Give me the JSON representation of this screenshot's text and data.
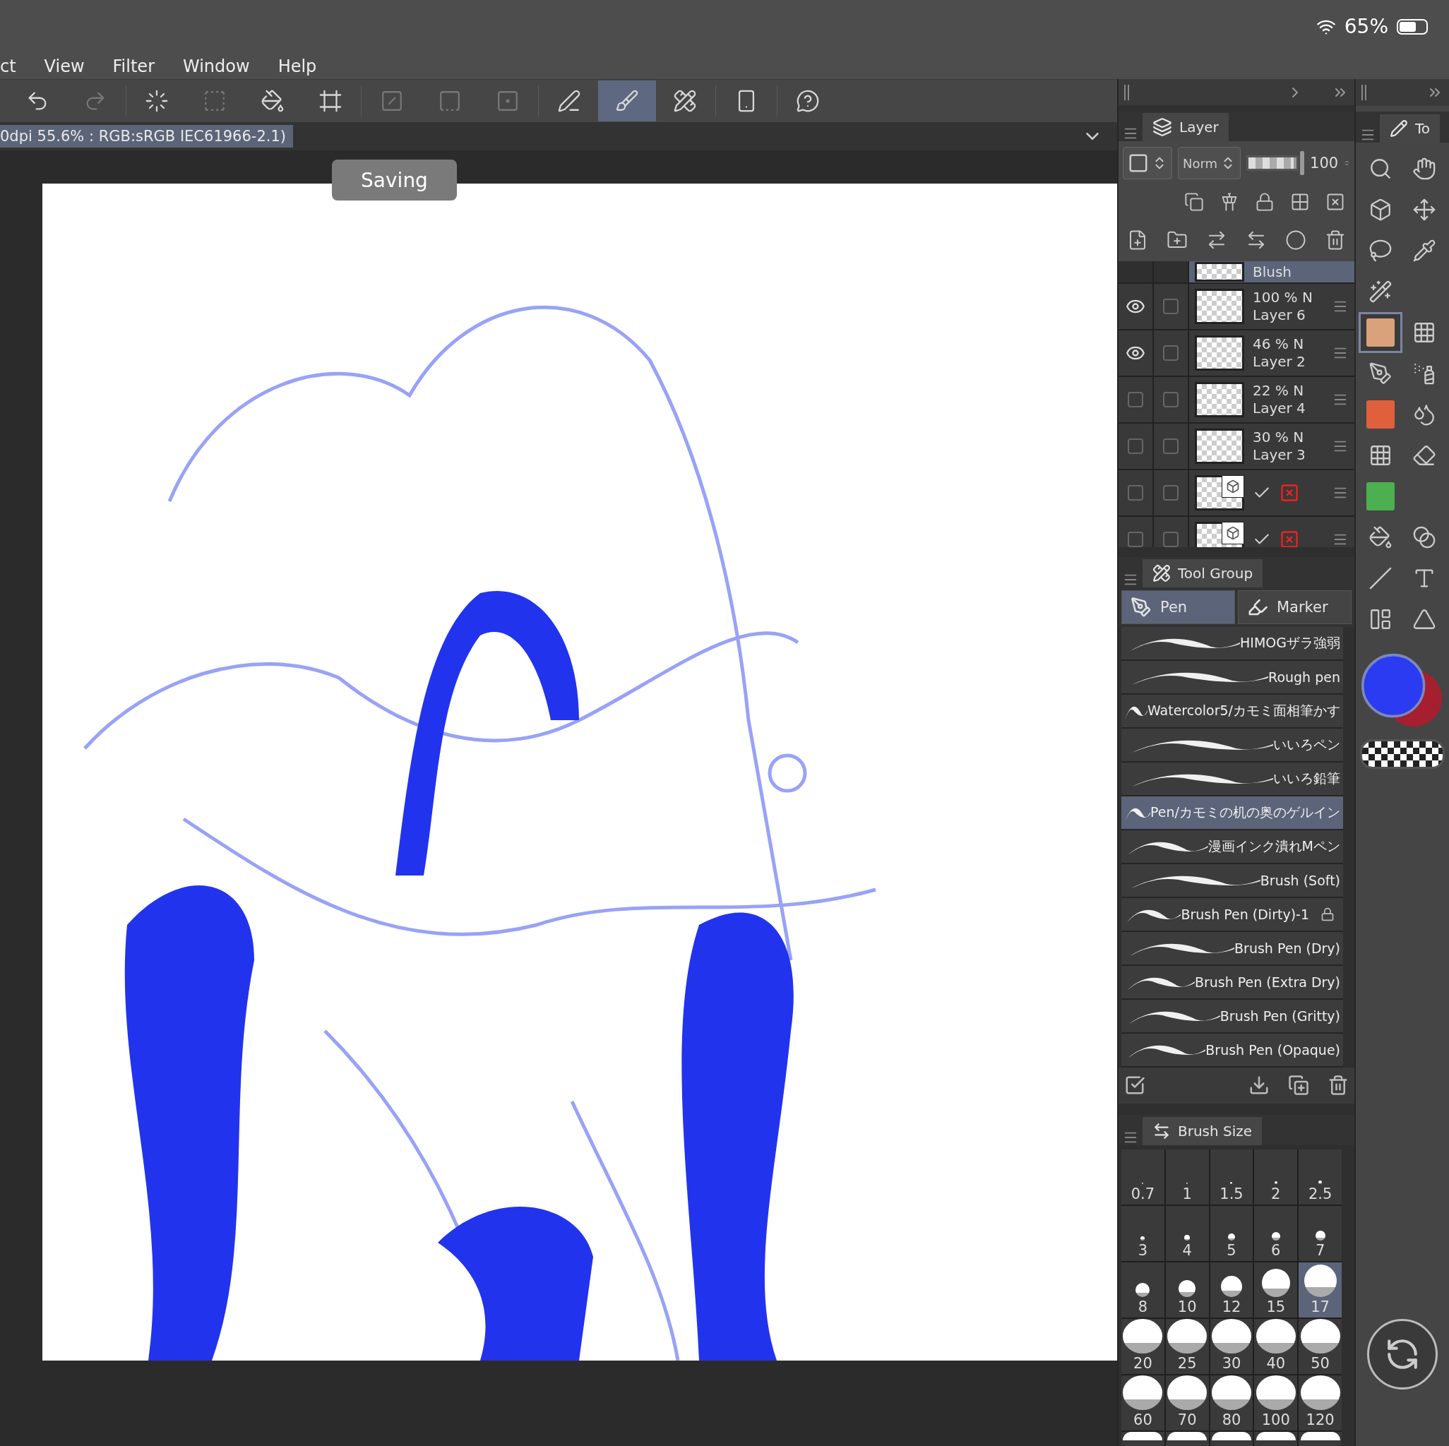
{
  "status_bar": {
    "battery": "65%"
  },
  "menu": [
    "ct",
    "View",
    "Filter",
    "Window",
    "Help"
  ],
  "toolbar": [
    {
      "selected": false,
      "disabled": false
    },
    {
      "selected": false,
      "disabled": true
    },
    {
      "selected": false,
      "disabled": false
    },
    {
      "selected": false,
      "disabled": true
    },
    {
      "selected": false,
      "disabled": false
    },
    {
      "selected": false,
      "disabled": false
    },
    {
      "selected": false,
      "disabled": true
    },
    {
      "selected": false,
      "disabled": true
    },
    {
      "selected": false,
      "disabled": true
    },
    {
      "selected": false,
      "disabled": false
    },
    {
      "selected": true,
      "disabled": false
    },
    {
      "selected": false,
      "disabled": false
    },
    {
      "selected": false,
      "disabled": false
    },
    {
      "selected": false,
      "disabled": false
    }
  ],
  "info_bar": {
    "text": "0dpi 55.6% : RGB:sRGB IEC61966-2.1)"
  },
  "toast": "Saving",
  "layer_panel": {
    "tab": "Layer",
    "blend_mode": "Norm",
    "opacity": "100",
    "opacity_slider": {
      "level": 1
    },
    "layers": [
      {
        "kind": "partial",
        "name": "Blush",
        "selected": true
      },
      {
        "kind": "raster",
        "opacity": "100 % N",
        "name": "Layer 6",
        "visible": true,
        "checked": false,
        "selected": false
      },
      {
        "kind": "raster",
        "opacity": "46 % N",
        "name": "Layer 2",
        "visible": true,
        "checked": false,
        "selected": false
      },
      {
        "kind": "raster",
        "opacity": "22 % N",
        "name": "Layer 4",
        "visible": false,
        "checked": false,
        "selected": false
      },
      {
        "kind": "raster",
        "opacity": "30 % N",
        "name": "Layer 3",
        "visible": false,
        "checked": false,
        "selected": false
      },
      {
        "kind": "model",
        "visible": false,
        "checked": false,
        "selected": false
      },
      {
        "kind": "model",
        "visible": false,
        "checked": false,
        "selected": false
      }
    ]
  },
  "tool_group": {
    "tab": "Tool Group",
    "tabs": [
      {
        "label": "Pen",
        "selected": true
      },
      {
        "label": "Marker",
        "selected": false
      }
    ],
    "brushes": [
      {
        "name": "HIMOGザラ強弱",
        "selected": false,
        "locked": false
      },
      {
        "name": "Rough pen",
        "selected": false,
        "locked": false
      },
      {
        "name": "Watercolor5/カモミ面相筆かす",
        "selected": false,
        "locked": false
      },
      {
        "name": "いいろペン",
        "selected": false,
        "locked": false
      },
      {
        "name": "いいろ鉛筆",
        "selected": false,
        "locked": false
      },
      {
        "name": "Pen/カモミの机の奥のゲルイン",
        "selected": true,
        "locked": false
      },
      {
        "name": "漫画インク潰れMペン",
        "selected": false,
        "locked": false
      },
      {
        "name": "Brush (Soft)",
        "selected": false,
        "locked": false
      },
      {
        "name": "Brush Pen (Dirty)-1",
        "selected": false,
        "locked": true
      },
      {
        "name": "Brush Pen (Dry)",
        "selected": false,
        "locked": false
      },
      {
        "name": "Brush Pen (Extra Dry)",
        "selected": false,
        "locked": false
      },
      {
        "name": "Brush Pen (Gritty)",
        "selected": false,
        "locked": false
      },
      {
        "name": "Brush Pen (Opaque)",
        "selected": false,
        "locked": false
      }
    ]
  },
  "brush_size": {
    "tab": "Brush Size",
    "sizes": [
      {
        "label": "0.7",
        "selected": false
      },
      {
        "label": "1",
        "selected": false
      },
      {
        "label": "1.5",
        "selected": false
      },
      {
        "label": "2",
        "selected": false
      },
      {
        "label": "2.5",
        "selected": false
      },
      {
        "label": "3",
        "selected": false
      },
      {
        "label": "4",
        "selected": false
      },
      {
        "label": "5",
        "selected": false
      },
      {
        "label": "6",
        "selected": false
      },
      {
        "label": "7",
        "selected": false
      },
      {
        "label": "8",
        "selected": false
      },
      {
        "label": "10",
        "selected": false
      },
      {
        "label": "12",
        "selected": false
      },
      {
        "label": "15",
        "selected": false
      },
      {
        "label": "17",
        "selected": true
      },
      {
        "label": "20",
        "selected": false
      },
      {
        "label": "25",
        "selected": false
      },
      {
        "label": "30",
        "selected": false
      },
      {
        "label": "40",
        "selected": false
      },
      {
        "label": "50",
        "selected": false
      },
      {
        "label": "60",
        "selected": false
      },
      {
        "label": "70",
        "selected": false
      },
      {
        "label": "80",
        "selected": false
      },
      {
        "label": "100",
        "selected": false
      },
      {
        "label": "120",
        "selected": false
      }
    ]
  },
  "toolbox": {
    "tab": "To",
    "tools": [
      {
        "selected": false
      },
      {
        "selected": false
      },
      {
        "selected": false
      },
      {
        "selected": false
      },
      {
        "selected": false
      },
      {
        "selected": false
      },
      {
        "selected": false
      },
      {
        "selected": true
      },
      {
        "selected": false
      },
      {
        "selected": false
      },
      {
        "selected": false
      },
      {
        "selected": false
      },
      {
        "selected": false
      },
      {
        "selected": false
      },
      {
        "selected": false
      },
      {
        "selected": false
      },
      {
        "selected": false
      },
      {
        "selected": false
      },
      {
        "selected": false
      },
      {
        "selected": false
      },
      {
        "selected": false
      },
      {
        "selected": false
      }
    ],
    "color_swatches": [
      {
        "color": "#2a3bf2"
      },
      {
        "color": "#a51f30"
      }
    ]
  }
}
